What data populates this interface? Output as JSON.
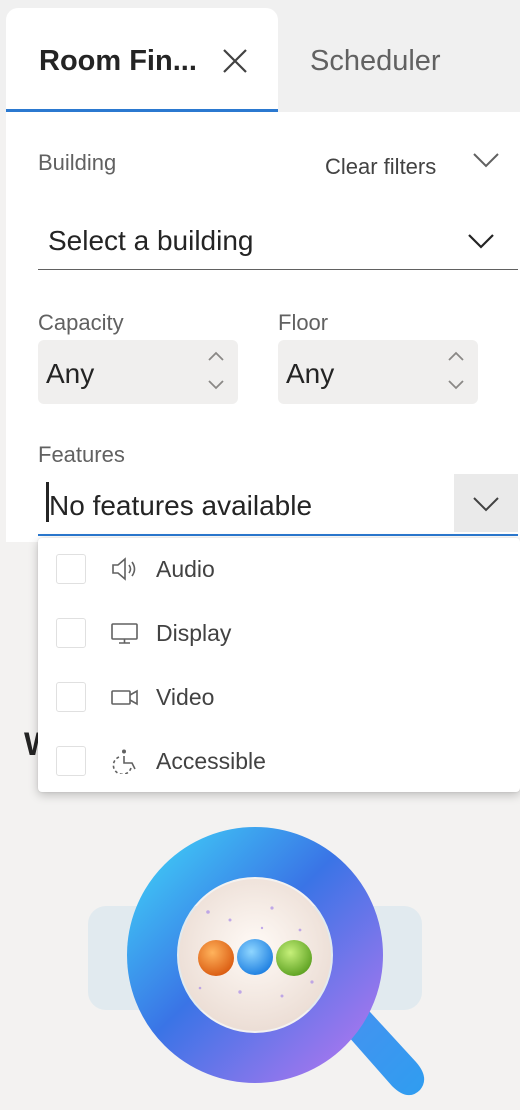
{
  "tabs": [
    {
      "label": "Room Fin...",
      "active": true,
      "close_icon": "close-icon"
    },
    {
      "label": "Scheduler",
      "active": false
    }
  ],
  "filters": {
    "building_label": "Building",
    "clear_filters": "Clear filters",
    "building_select_value": "Select a building",
    "capacity_label": "Capacity",
    "capacity_value": "Any",
    "floor_label": "Floor",
    "floor_value": "Any",
    "features_label": "Features",
    "features_value": "No features available"
  },
  "feature_options": [
    {
      "label": "Audio",
      "icon": "speaker-icon",
      "checked": false
    },
    {
      "label": "Display",
      "icon": "monitor-icon",
      "checked": false
    },
    {
      "label": "Video",
      "icon": "camera-icon",
      "checked": false
    },
    {
      "label": "Accessible",
      "icon": "accessibility-icon",
      "checked": false
    }
  ],
  "background_text": "W",
  "colors": {
    "accent": "#2b79d0",
    "panel": "#ffffff",
    "background": "#f3f2f1"
  }
}
